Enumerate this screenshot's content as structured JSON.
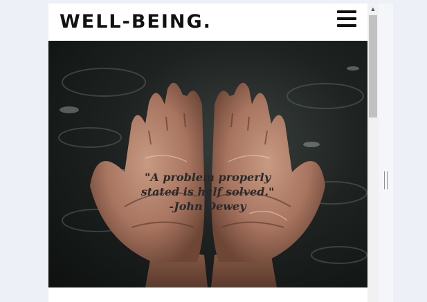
{
  "header": {
    "logo_text": "WELL-BEING.",
    "menu_icon": "hamburger-icon"
  },
  "hero": {
    "image_subject": "cupped hands in water",
    "quote_lines": [
      "\"A problem properly",
      "stated is half solved.\"",
      "-John Dewey"
    ]
  },
  "scrollbar": {
    "up_arrow_icon": "arrow-up-icon",
    "up_arrow_glyph": "▲"
  },
  "colors": {
    "header_bg": "#ffffff",
    "logo_color": "#111111",
    "quote_color": "#2a2a2a"
  }
}
